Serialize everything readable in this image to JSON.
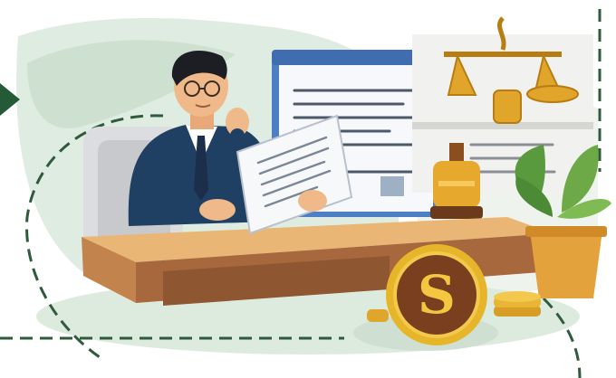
{
  "illustration": {
    "subject": "businessman-reading-document-at-desk",
    "coin_symbol": "S",
    "colors": {
      "suit": "#1f3f63",
      "desk_top": "#e9b675",
      "desk_front": "#a6683c",
      "coin_gold": "#e7b52a",
      "coin_brown": "#7a3f1e",
      "plant_green": "#5a9a3e",
      "pot": "#e4a23c",
      "backdrop_green": "#cfe3d3",
      "dashed_line": "#2f5a3c",
      "screen_frame": "#4d7fc4"
    }
  }
}
